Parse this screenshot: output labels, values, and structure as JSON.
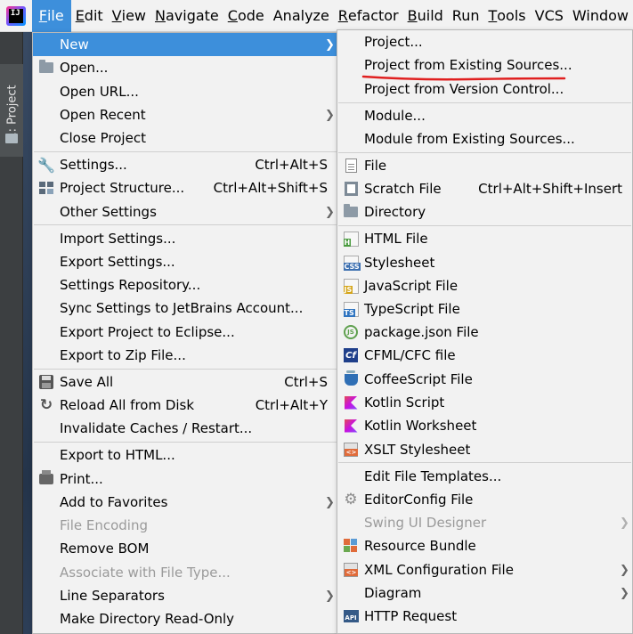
{
  "menubar": {
    "items": [
      {
        "label": "File",
        "mnemonic": "F",
        "rest": "ile"
      },
      {
        "label": "Edit",
        "mnemonic": "E",
        "rest": "dit"
      },
      {
        "label": "View",
        "mnemonic": "V",
        "rest": "iew"
      },
      {
        "label": "Navigate",
        "mnemonic": "N",
        "rest": "avigate"
      },
      {
        "label": "Code",
        "mnemonic": "C",
        "rest": "ode"
      },
      {
        "label": "Analyze",
        "mnemonic": "",
        "rest": "Analyze"
      },
      {
        "label": "Refactor",
        "mnemonic": "R",
        "rest": "efactor"
      },
      {
        "label": "Build",
        "mnemonic": "B",
        "rest": "uild"
      },
      {
        "label": "Run",
        "mnemonic": "",
        "rest": "Run"
      },
      {
        "label": "Tools",
        "mnemonic": "T",
        "rest": "ools"
      },
      {
        "label": "VCS",
        "mnemonic": "",
        "rest": "VCS"
      },
      {
        "label": "Window",
        "mnemonic": "",
        "rest": "Window"
      }
    ]
  },
  "sidebar": {
    "project_tab_label": "1: Project"
  },
  "file_menu": {
    "new": "New",
    "open": "Open...",
    "open_url": "Open URL...",
    "open_recent": "Open Recent",
    "close_project": "Close Project",
    "settings": "Settings...",
    "settings_shortcut": "Ctrl+Alt+S",
    "project_structure": "Project Structure...",
    "project_structure_shortcut": "Ctrl+Alt+Shift+S",
    "other_settings": "Other Settings",
    "import_settings": "Import Settings...",
    "export_settings": "Export Settings...",
    "settings_repository": "Settings Repository...",
    "sync_settings": "Sync Settings to JetBrains Account...",
    "export_eclipse": "Export Project to Eclipse...",
    "export_zip": "Export to Zip File...",
    "save_all": "Save All",
    "save_all_shortcut": "Ctrl+S",
    "reload_disk": "Reload All from Disk",
    "reload_disk_shortcut": "Ctrl+Alt+Y",
    "invalidate_caches": "Invalidate Caches / Restart...",
    "export_html": "Export to HTML...",
    "print": "Print...",
    "add_favorites": "Add to Favorites",
    "file_encoding": "File Encoding",
    "remove_bom": "Remove BOM",
    "associate_file_type": "Associate with File Type...",
    "line_separators": "Line Separators",
    "make_read_only": "Make Directory Read-Only"
  },
  "new_submenu": {
    "project": "Project...",
    "project_existing": "Project from Existing Sources...",
    "project_vcs": "Project from Version Control...",
    "module": "Module...",
    "module_existing": "Module from Existing Sources...",
    "file": "File",
    "scratch_file": "Scratch File",
    "scratch_file_shortcut": "Ctrl+Alt+Shift+Insert",
    "directory": "Directory",
    "html_file": "HTML File",
    "stylesheet": "Stylesheet",
    "javascript_file": "JavaScript File",
    "typescript_file": "TypeScript File",
    "package_json": "package.json File",
    "cfml_file": "CFML/CFC file",
    "coffeescript_file": "CoffeeScript File",
    "kotlin_script": "Kotlin Script",
    "kotlin_worksheet": "Kotlin Worksheet",
    "xslt_stylesheet": "XSLT Stylesheet",
    "edit_templates": "Edit File Templates...",
    "editorconfig": "EditorConfig File",
    "swing_ui_designer": "Swing UI Designer",
    "resource_bundle": "Resource Bundle",
    "xml_config": "XML Configuration File",
    "diagram": "Diagram",
    "http_request": "HTTP Request"
  },
  "icon_badges": {
    "html": "H",
    "css": "CSS",
    "js": "JS",
    "ts": "TS",
    "cf": "Cf",
    "api": "API",
    "node": "JS",
    "xml": "<>"
  },
  "colors": {
    "highlight": "#3d8fdb",
    "menu_bg": "#f2f2f2",
    "annotation_red": "#e02020"
  }
}
